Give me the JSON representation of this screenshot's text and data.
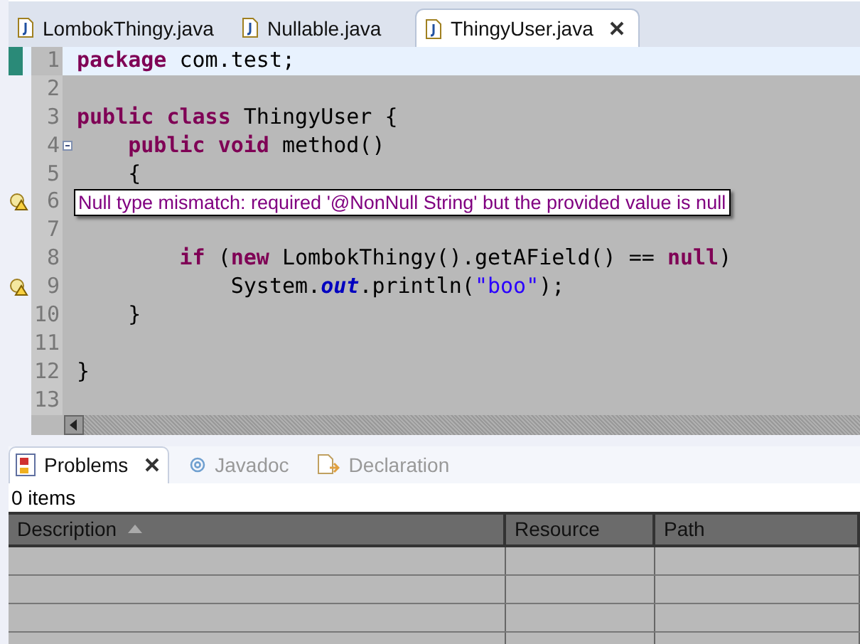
{
  "editor_tabs": [
    {
      "label": "LombokThingy.java",
      "selected": false
    },
    {
      "label": "Nullable.java",
      "selected": false
    },
    {
      "label": "ThingyUser.java",
      "selected": true
    }
  ],
  "editor": {
    "lines": [
      {
        "kind": "plain",
        "number": "1",
        "current": true,
        "tokens": [
          {
            "kind": "keyword",
            "text": "package"
          },
          {
            "kind": "plain",
            "text": " com.test;"
          }
        ]
      },
      {
        "kind": "plain",
        "number": "2",
        "current": false
      },
      {
        "kind": "plain",
        "number": "3",
        "current": false,
        "tokens": [
          {
            "kind": "keyword",
            "text": "public"
          },
          {
            "kind": "keyword",
            "text": " class"
          },
          {
            "kind": "plain",
            "text": " ThingyUser {"
          }
        ]
      },
      {
        "kind": "fold",
        "number": "4",
        "current": false,
        "tokens": [
          {
            "kind": "keyword",
            "text": "    public"
          },
          {
            "kind": "keyword",
            "text": " void"
          },
          {
            "kind": "plain",
            "text": " method()"
          }
        ]
      },
      {
        "kind": "plain",
        "number": "5",
        "current": false,
        "tokens": [
          {
            "kind": "plain",
            "text": "    {"
          }
        ]
      },
      {
        "kind": "warning",
        "number": "6",
        "current": false,
        "tooltip": "Null type mismatch: required '@NonNull String' but the provided value is null"
      },
      {
        "kind": "plain",
        "number": "7",
        "current": false
      },
      {
        "kind": "plain",
        "number": "8",
        "current": false,
        "tokens": [
          {
            "kind": "keyword",
            "text": "        if"
          },
          {
            "kind": "plain",
            "text": " ("
          },
          {
            "kind": "keyword",
            "text": "new"
          },
          {
            "kind": "plain",
            "text": " LombokThingy().getAField() == "
          },
          {
            "kind": "keyword",
            "text": "null"
          },
          {
            "kind": "plain",
            "text": ")"
          }
        ]
      },
      {
        "kind": "warning",
        "number": "9",
        "current": false,
        "tokens": [
          {
            "kind": "plain",
            "text": "            System."
          },
          {
            "kind": "static",
            "text": "out"
          },
          {
            "kind": "plain",
            "text": ".println("
          },
          {
            "kind": "string",
            "text": "\"boo\""
          },
          {
            "kind": "plain",
            "text": ");"
          }
        ]
      },
      {
        "kind": "plain",
        "number": "10",
        "current": false,
        "tokens": [
          {
            "kind": "plain",
            "text": "    }"
          }
        ]
      },
      {
        "kind": "plain",
        "number": "11",
        "current": false
      },
      {
        "kind": "plain",
        "number": "12",
        "current": false,
        "tokens": [
          {
            "kind": "plain",
            "text": "}"
          }
        ]
      },
      {
        "kind": "plain",
        "number": "13",
        "current": false
      }
    ]
  },
  "view_tabs": [
    {
      "kind": "problems",
      "label": "Problems",
      "selected": true
    },
    {
      "kind": "javadoc",
      "label": "Javadoc",
      "selected": false
    },
    {
      "kind": "declaration",
      "label": "Declaration",
      "selected": false
    }
  ],
  "problems": {
    "count": "0 items",
    "columns": [
      {
        "label": "Description",
        "sorted": true
      },
      {
        "label": "Resource",
        "sorted": false
      },
      {
        "label": "Path",
        "sorted": false
      }
    ]
  }
}
